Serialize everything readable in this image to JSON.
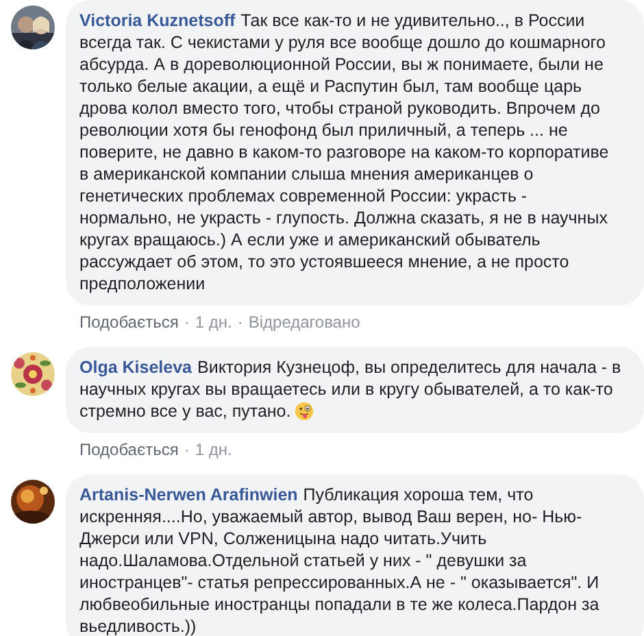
{
  "comments": [
    {
      "author": "Victoria Kuznetsoff",
      "text": "Так все как-то и не удивительно.., в России всегда так. С чекистами у руля все вообще дошло до кошмарного абсурда. А в дореволюционной России, вы ж понимаете, были не только белые акации, а ещё и Распутин был, там вообще царь дрова колол вместо того, чтобы страной руководить. Впрочем до революции хотя бы генофонд был приличный, а теперь ... не поверите, не давно в каком-то разговоре на каком-то корпоративе в американской компании слыша мнения американцев о генетических проблемах современной России: украсть - нормально, не украсть - глупость. Должна сказать, я не в научных кругах вращаюсь.) А если уже и американский обыватель рассуждает об этом, то это устоявшееся мнение, а не просто предположении",
      "emoji": false,
      "actions": [
        {
          "kind": "link",
          "text": "Подобається"
        },
        {
          "kind": "sep",
          "text": "·"
        },
        {
          "kind": "time",
          "text": "1 дн."
        },
        {
          "kind": "sep",
          "text": "·"
        },
        {
          "kind": "note",
          "text": "Відредаговано"
        }
      ]
    },
    {
      "author": "Olga Kiseleva",
      "text": "Виктория Кузнецоф, вы определитесь для начала - в научных кругах вы вращаетесь или в кругу обывателей, а то как-то стремно все у вас, путано.",
      "emoji": true,
      "actions": [
        {
          "kind": "link",
          "text": "Подобається"
        },
        {
          "kind": "sep",
          "text": "·"
        },
        {
          "kind": "time",
          "text": "1 дн."
        }
      ]
    },
    {
      "author": "Artanis-Nerwen Arafinwien",
      "text": "Публикация хороша тем, что искренняя....Но, уважаемый автор, вывод Ваш верен, но- Нью-Джерси или VPN, Солженицына надо читать.Учить надо.Шаламова.Отдельной статьей у них - \" девушки за иностранцев\"- статья репрессированных.А не - \" оказывается\". И любвеобильные иностранцы попадали в те же колеса.Пардон за вьедливость.))",
      "emoji": false
    }
  ]
}
